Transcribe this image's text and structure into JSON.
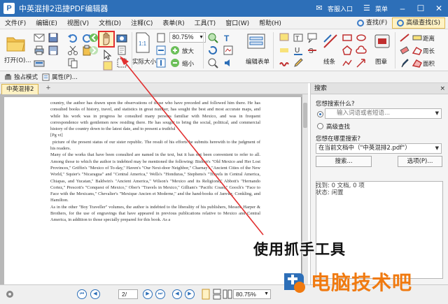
{
  "window": {
    "title": "中英混排2迅捷PDF编辑器",
    "logo_letter": "P",
    "service_label": "客服入口",
    "menu_label": "菜单"
  },
  "menubar": {
    "items": [
      "文件(F)",
      "编辑(E)",
      "视图(V)",
      "文档(D)",
      "注释(C)",
      "表单(R)",
      "工具(T)",
      "窗口(W)",
      "帮助(H)"
    ],
    "find_label": "查找(F)",
    "advanced_find_label": "高级查找(S)"
  },
  "ribbon": {
    "open_label": "打开(O)...",
    "zoom_value": "80.75%",
    "actual_size_label": "实际大小",
    "zoom_in_label": "放大",
    "zoom_out_label": "缩小",
    "edit_form_label": "编辑表单",
    "lines_label": "线条",
    "stamp_label": "图章",
    "distance_label": "距离",
    "perimeter_label": "周长",
    "area_label": "面积",
    "one_to_one": "1:1"
  },
  "toolbar2": {
    "exclusive_mode_label": "独占模式",
    "properties_label": "属性(P)..."
  },
  "tabs": {
    "doc_tab_label": "中英混排2",
    "add_label": "+"
  },
  "document": {
    "paragraphs": [
      "country, the author has drawn upon the observations of those who have preceded and followed him there. He has consulted books of history, travel, and statistics in great number, has sought the best and most accurate maps, and while his work was in progress he consulted many persons familiar with Mexico, and was in frequent correspondence with gentlemen now residing there. He has sought to bring the social, political, and commercial history of the country down to the latest date, and to present a truthful",
      "[Pg vi]",
      "picture of the present status of our sister republic. The result of his efforts he submits herewith to the judgment of his readers.",
      "Many of the works that have been consulted are named in the text, but it has not been convenient to refer to all. Among those to which the author is indebted may be mentioned the following: Bishop's \"Old Mexico and Her Lost Provinces,\" Griffin's \"Mexico of To-day,\" Haven's \"Our Next-door Neighbor,\" Charnay's \"Ancient Cities of the New World,\" Squier's \"Nicaragua\" and \"Central America,\" Wells's \"Honduras,\" Stephens's \"Travels in Central America, Chiapas, and Yucatan,\" Baldwin's \"Ancient America,\" Wilson's \"Mexico and its Religions,\" Abbott's \"Hernando Cortez,\" Prescott's \"Conquest of Mexico,\" Ober's \"Travels in Mexico,\" Gilliam's \"Pacific Coast,\" Gooch's \"Face to Face with the Mexicans,\" Chevalier's \"Mexique Ancien et Moderne,\" and the hand-books of Janvier, Conkling, and Hamilton.",
      "As in the other \"Boy Traveller\" volumes, the author is indebted to the liberality of his publishers, Messrs. Harper & Brothers, for the use of engravings that have appeared in previous publications relative to Mexico and Central America, in addition to those specially prepared for this book. As a"
    ]
  },
  "search_panel": {
    "title": "搜索",
    "close_label": "×",
    "question_what": "您想搜索什么?",
    "input_placeholder": "输入词语或者短语...",
    "advanced_label": "高级查找",
    "question_where": "您想在哪里搜索?",
    "scope_value": "在当前文档中（\"中英混排2.pdf\"）",
    "search_button": "搜索...",
    "options_button": "选项(P)...",
    "found_text": "找到: 0 文档, 0 项",
    "status_text": "状态: 闲置"
  },
  "statusbar": {
    "page_value": "2/",
    "zoom_value": "80.75%"
  },
  "overlay": {
    "annotation_text": "使用抓手工具",
    "watermark_text": "电脑技术吧"
  },
  "colors": {
    "titlebar": "#2d6fb8",
    "highlight": "#e23030",
    "watermark": "#f07a10",
    "active_tab": "#fff2c4"
  }
}
